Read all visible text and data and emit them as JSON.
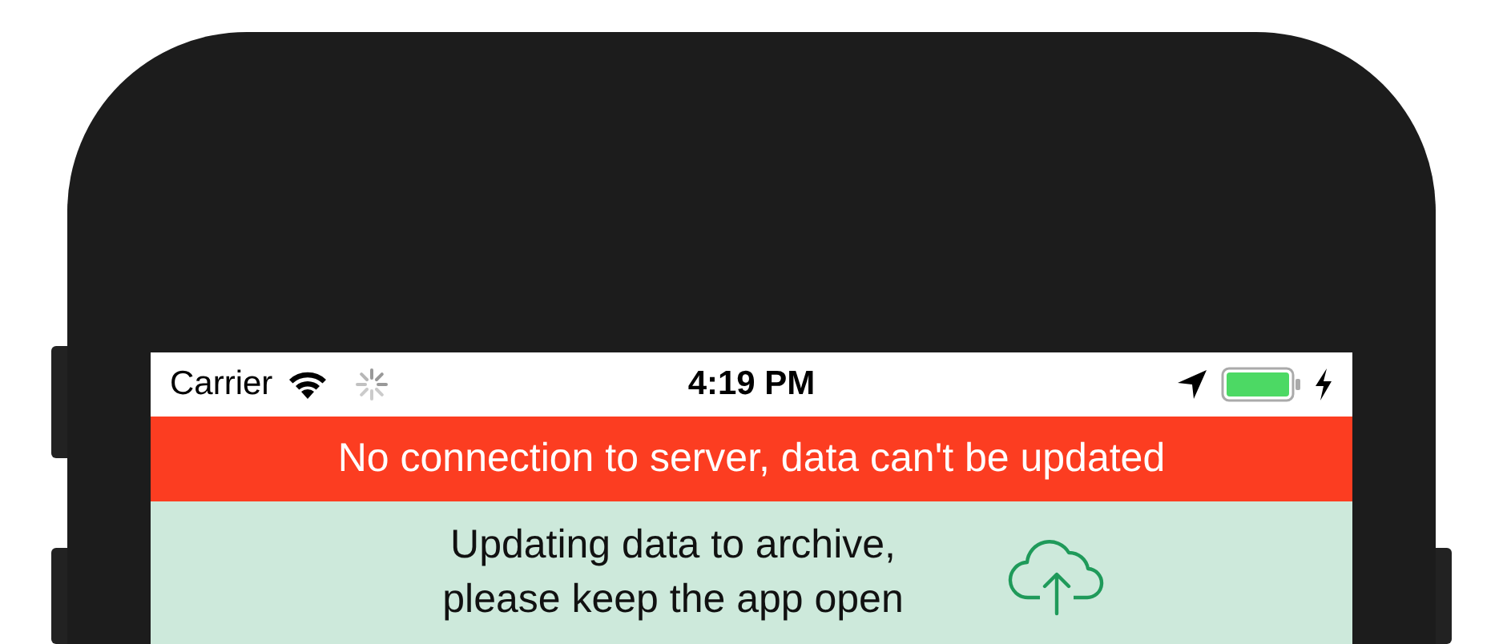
{
  "status_bar": {
    "carrier": "Carrier",
    "time": "4:19 PM"
  },
  "error_banner": {
    "text": "No connection to server, data can't be updated"
  },
  "sync_notice": {
    "text": "Updating data to archive, please keep the app open"
  }
}
